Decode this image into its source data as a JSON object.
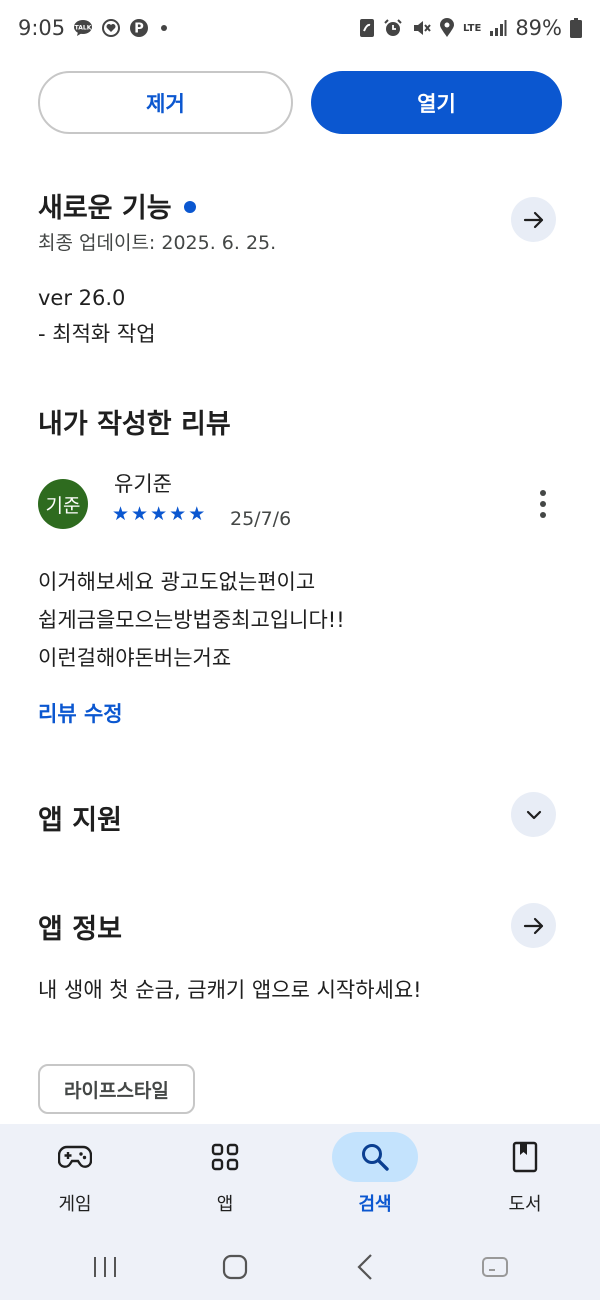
{
  "status_bar": {
    "time": "9:05",
    "battery_percent": "89%",
    "network": "LTE",
    "left_icons": [
      "talk-icon",
      "heart-circle-icon",
      "p-circle-icon"
    ],
    "right_icons": [
      "nfc-icon",
      "alarm-icon",
      "mute-icon",
      "location-icon",
      "lte-icon",
      "signal-icon",
      "battery-icon"
    ]
  },
  "actions": {
    "uninstall_label": "제거",
    "open_label": "열기"
  },
  "whats_new": {
    "title": "새로운 기능",
    "last_updated": "최종 업데이트: 2025. 6. 25.",
    "version": "ver 26.0",
    "notes": "- 최적화 작업"
  },
  "my_review": {
    "title": "내가 작성한 리뷰",
    "avatar_text": "기준",
    "reviewer_name": "유기준",
    "rating": 5,
    "date": "25/7/6",
    "lines": [
      "이거해보세요 광고도없는편이고",
      "쉽게금을모으는방법중최고입니다!!",
      "이런걸해야돈버는거죠"
    ],
    "edit_label": "리뷰 수정"
  },
  "app_support": {
    "title": "앱 지원"
  },
  "app_info": {
    "title": "앱 정보",
    "description": "내 생애 첫 순금, 금캐기 앱으로 시작하세요!",
    "category_chip": "라이프스타일"
  },
  "bottom_nav": {
    "items": [
      {
        "label": "게임",
        "icon": "gamepad-icon"
      },
      {
        "label": "앱",
        "icon": "apps-grid-icon"
      },
      {
        "label": "검색",
        "icon": "search-icon",
        "active": true
      },
      {
        "label": "도서",
        "icon": "book-icon"
      }
    ]
  },
  "colors": {
    "accent": "#0b57d0",
    "avatar_bg": "#2e6b1f",
    "nav_bg": "#eef1f8",
    "active_pill": "#c4e3fd"
  }
}
